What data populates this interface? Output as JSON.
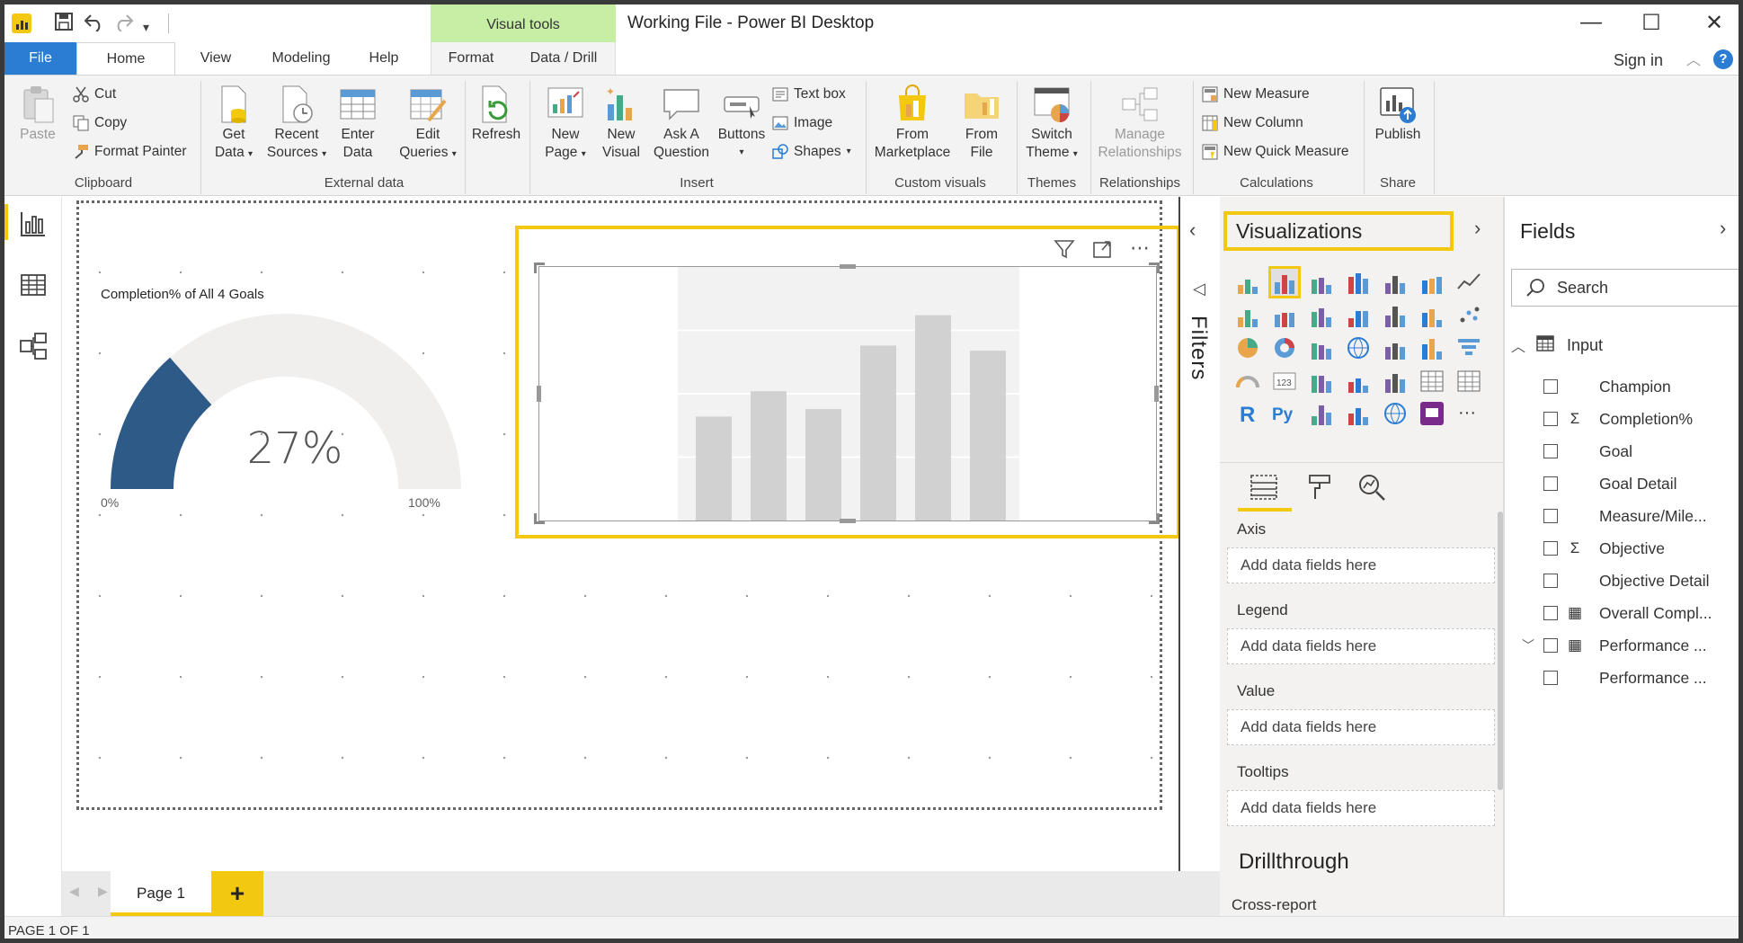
{
  "window": {
    "title": "Working File - Power BI Desktop",
    "contextual_tab_group": "Visual tools",
    "controls": [
      "minimize",
      "maximize",
      "close"
    ]
  },
  "tabs": [
    {
      "label": "File",
      "active": false
    },
    {
      "label": "Home",
      "active": true
    },
    {
      "label": "View"
    },
    {
      "label": "Modeling"
    },
    {
      "label": "Help"
    },
    {
      "label": "Format"
    },
    {
      "label": "Data / Drill"
    }
  ],
  "signin": "Sign in",
  "help_icon": "?",
  "ribbon": {
    "clipboard": {
      "paste": "Paste",
      "cut": "Cut",
      "copy": "Copy",
      "format_painter": "Format Painter",
      "label": "Clipboard"
    },
    "external": {
      "get_data_1": "Get",
      "get_data_2": "Data",
      "recent_1": "Recent",
      "recent_2": "Sources",
      "enter_1": "Enter",
      "enter_2": "Data",
      "edit_1": "Edit",
      "edit_2": "Queries",
      "refresh": "Refresh",
      "label": "External data"
    },
    "insert": {
      "new_page_1": "New",
      "new_page_2": "Page",
      "new_visual_1": "New",
      "new_visual_2": "Visual",
      "ask_1": "Ask A",
      "ask_2": "Question",
      "buttons": "Buttons",
      "text_box": "Text box",
      "image": "Image",
      "shapes": "Shapes",
      "label": "Insert"
    },
    "custom": {
      "market_1": "From",
      "market_2": "Marketplace",
      "file_1": "From",
      "file_2": "File",
      "label": "Custom visuals"
    },
    "themes": {
      "switch_1": "Switch",
      "switch_2": "Theme",
      "label": "Themes"
    },
    "relationships": {
      "manage_1": "Manage",
      "manage_2": "Relationships",
      "label": "Relationships"
    },
    "calculations": {
      "new_measure": "New Measure",
      "new_column": "New Column",
      "new_quick_measure": "New Quick Measure",
      "label": "Calculations"
    },
    "share": {
      "publish": "Publish",
      "label": "Share"
    }
  },
  "canvas": {
    "gauge": {
      "title": "Completion% of All 4 Goals",
      "value_label": "27%",
      "value": 0.27,
      "min_label": "0%",
      "max_label": "100%",
      "fill_color": "#2e5a88",
      "track_color": "#f0efee"
    },
    "placeholder_chart": {
      "type": "bar",
      "values": [
        41,
        51,
        44,
        69,
        81,
        67
      ],
      "bar_color": "#d1d1d1",
      "plot_bg": "#f2f2f2"
    }
  },
  "filters_label": "Filters",
  "visualizations": {
    "title": "Visualizations",
    "icons": [
      "stacked-bar-icon",
      "stacked-column-icon",
      "clustered-bar-icon",
      "clustered-column-icon",
      "100-bar-icon",
      "100-column-icon",
      "line-chart-icon",
      "area-chart-icon",
      "stacked-area-icon",
      "line-column-icon",
      "line-clustered-icon",
      "ribbon-chart-icon",
      "waterfall-icon",
      "scatter-icon",
      "pie-chart-icon",
      "donut-chart-icon",
      "treemap-icon",
      "map-icon",
      "filled-map-icon",
      "shape-map-icon",
      "funnel-icon",
      "gauge-icon",
      "card-icon",
      "multirow-card-icon",
      "kpi-icon",
      "slicer-icon",
      "table-icon",
      "matrix-icon",
      "r-visual-icon",
      "python-visual-icon",
      "key-influencers-icon",
      "qna-icon",
      "arcgis-icon",
      "custom-visual-icon",
      "more-visuals-icon"
    ],
    "selected_icon_index": 1,
    "wells": [
      {
        "label": "Axis",
        "placeholder": "Add data fields here"
      },
      {
        "label": "Legend",
        "placeholder": "Add data fields here"
      },
      {
        "label": "Value",
        "placeholder": "Add data fields here"
      },
      {
        "label": "Tooltips",
        "placeholder": "Add data fields here"
      }
    ],
    "drillthrough": "Drillthrough",
    "cross_report": "Cross-report"
  },
  "fields": {
    "title": "Fields",
    "search_placeholder": "Search",
    "table": "Input",
    "items": [
      {
        "name": "Champion",
        "icon": ""
      },
      {
        "name": "Completion%",
        "icon": "Σ"
      },
      {
        "name": "Goal",
        "icon": ""
      },
      {
        "name": "Goal Detail",
        "icon": ""
      },
      {
        "name": "Measure/Mile...",
        "icon": ""
      },
      {
        "name": "Objective",
        "icon": "Σ"
      },
      {
        "name": "Objective Detail",
        "icon": ""
      },
      {
        "name": "Overall Compl...",
        "icon": "▦"
      },
      {
        "name": "Performance ...",
        "icon": "▦",
        "expandable": true
      },
      {
        "name": "Performance ...",
        "icon": ""
      }
    ]
  },
  "pages": {
    "tabs": [
      "Page 1"
    ],
    "add": "+"
  },
  "status": "PAGE 1 OF 1"
}
